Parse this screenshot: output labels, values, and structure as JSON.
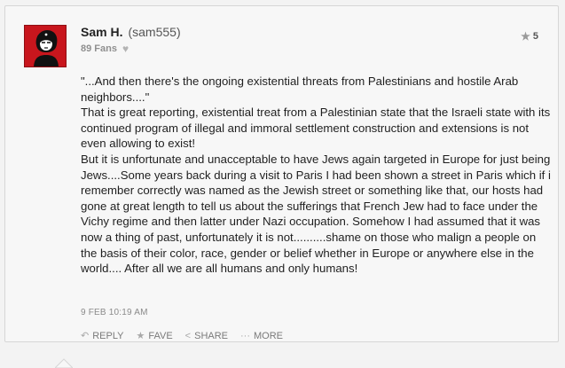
{
  "comment": {
    "author_name": "Sam H.",
    "author_handle": "(sam555)",
    "fans": "89 Fans",
    "rating": "5",
    "body": "\"...And then there's the ongoing existential threats from Palestinians and hostile Arab neighbors....\"\nThat is great reporting, existential treat from a Palestinian state that the Israeli state with its continued program of illegal and immoral settlement construction and extensions is not even allowing to exist!\nBut it is unfortunate and unacceptable to have Jews again targeted in Europe for just being Jews....Some years back during a visit to Paris I had been shown a street in Paris which if i remember correctly was named as the Jewish street or something like that, our hosts had gone at great length to tell us about the sufferings that French Jew had to face under the Vichy regime and then latter under Nazi occupation. Somehow I had assumed that it was now a thing of past, unfortunately it is not..........shame on those who malign a people on the basis of their color, race, gender or belief whether in Europe or anywhere else in the world.... After all we are all humans and only humans!",
    "timestamp": "9 FEB 10:19 AM"
  },
  "actions": {
    "reply": "REPLY",
    "fave": "FAVE",
    "share": "SHARE",
    "more": "MORE"
  },
  "colors": {
    "avatar_bg": "#c8161d",
    "card_bg": "#f7f7f7"
  },
  "icons": {
    "reply": "reply-icon",
    "fave": "star-icon",
    "share": "share-icon",
    "more": "ellipsis-icon",
    "fans": "heart-icon",
    "rating": "star-icon"
  }
}
